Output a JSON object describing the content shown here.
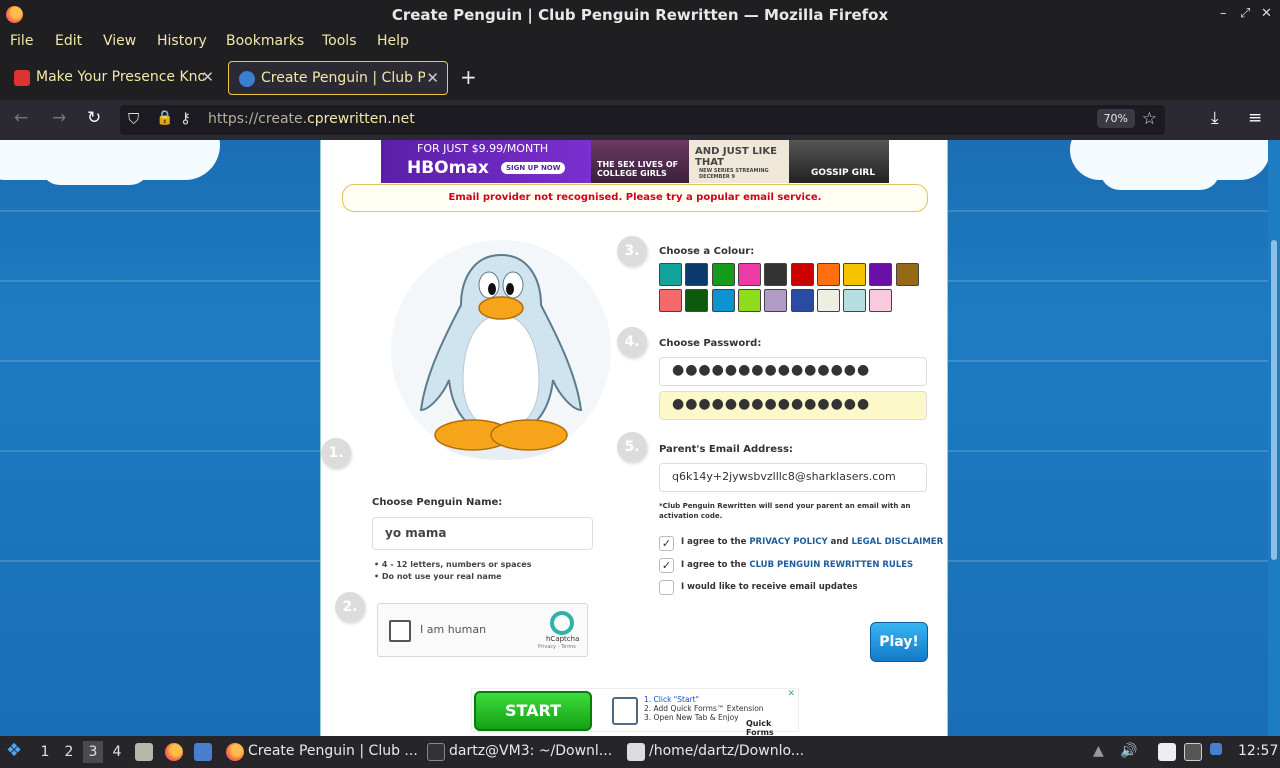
{
  "window": {
    "title": "Create Penguin | Club Penguin Rewritten — Mozilla Firefox",
    "controls": [
      "–",
      "⤢",
      "✕"
    ]
  },
  "menu": [
    "File",
    "Edit",
    "View",
    "History",
    "Bookmarks",
    "Tools",
    "Help"
  ],
  "tabs": [
    {
      "label": "Make Your Presence Known",
      "active": false
    },
    {
      "label": "Create Penguin | Club Penguin Rewritten",
      "active": true
    }
  ],
  "nav": {
    "url_prefix": "https://create.",
    "url_domain": "cprewritten.net",
    "zoom": "70%"
  },
  "page": {
    "ad_top": {
      "line1": "FOR JUST $9.99/MONTH",
      "brand": "HBOmax",
      "cta": "SIGN UP NOW",
      "panel1": "THE SEX LIVES OF COLLEGE GIRLS",
      "panel2": "AND JUST LIKE THAT",
      "panel2_sub": "NEW SERIES STREAMING DECEMBER 9",
      "panel3": "GOSSIP GIRL"
    },
    "error": "Email provider not recognised. Please try a popular email service.",
    "steps": {
      "s1": "1.",
      "s2": "2.",
      "s3": "3.",
      "s4": "4.",
      "s5": "5."
    },
    "name_label": "Choose Penguin Name:",
    "name_value": "yo mama",
    "name_hints": [
      "4 - 12 letters, numbers or spaces",
      "Do not use your real name"
    ],
    "captcha": {
      "text": "I am human",
      "brand": "hCaptcha",
      "links": "Privacy - Terms"
    },
    "colour_label": "Choose a Colour:",
    "colours": [
      "#13a39a",
      "#0b3a6e",
      "#159a1b",
      "#ee3aa4",
      "#333333",
      "#cc0000",
      "#ff6f0f",
      "#f7c200",
      "#6a0fa8",
      "#946b14",
      "#f46a6a",
      "#0c5a0c",
      "#0d93d1",
      "#8fdc1c",
      "#b09cc7",
      "#2a4aa3",
      "#efefe1",
      "#b5dfe1",
      "#f9c9dd"
    ],
    "password_label": "Choose Password:",
    "password_mask": "●●●●●●●●●●●●●●●",
    "password_confirm_mask": "●●●●●●●●●●●●●●●",
    "email_label": "Parent's Email Address:",
    "email_value": "q6k14y+2jywsbvzlllc8@sharklasers.com",
    "note": "*Club Penguin Rewritten will send your parent an email with an activation code.",
    "agree1_pre": "I agree to the ",
    "agree1_link1": "PRIVACY POLICY",
    "agree1_mid": " and ",
    "agree1_link2": "LEGAL DISCLAIMER",
    "agree2_pre": "I agree to the ",
    "agree2_link": "CLUB PENGUIN REWRITTEN RULES",
    "updates": "I would like to receive email updates",
    "play": "Play!",
    "ad_bottom": {
      "start": "START",
      "step1": "1. Click \"Start\"",
      "step2": "2. Add Quick Forms™ Extension",
      "step3": "3. Open New Tab & Enjoy",
      "brand": "Quick Forms",
      "close": "✕"
    }
  },
  "taskbar": {
    "workspaces": [
      "1",
      "2",
      "3",
      "4"
    ],
    "active_workspace": "3",
    "windows": [
      "Create Penguin | Club ...",
      "dartz@VM3: ~/Downl...",
      "/home/dartz/Downlo..."
    ],
    "clock": "12:57"
  }
}
